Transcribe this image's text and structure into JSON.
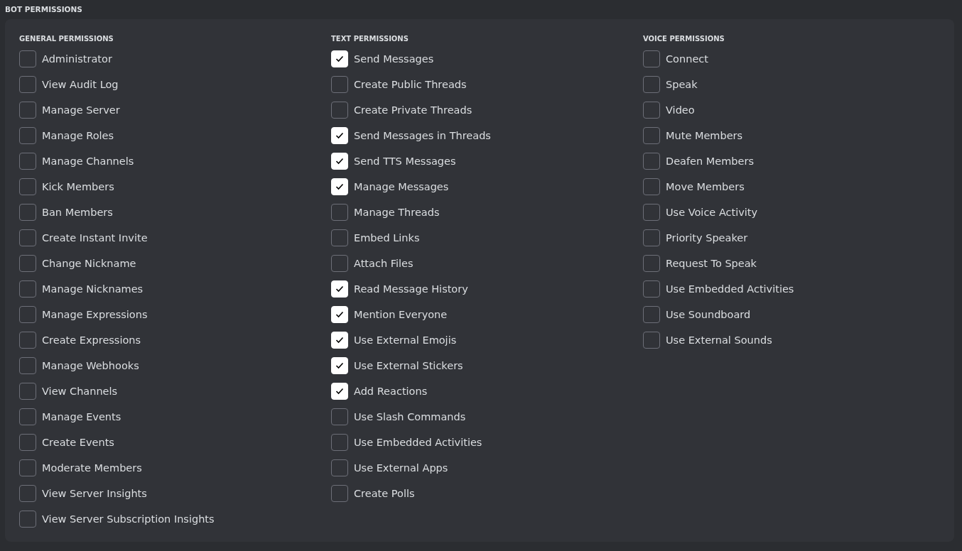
{
  "section_title": "BOT PERMISSIONS",
  "groups": [
    {
      "title": "GENERAL PERMISSIONS",
      "items": [
        {
          "label": "Administrator",
          "checked": false
        },
        {
          "label": "View Audit Log",
          "checked": false
        },
        {
          "label": "Manage Server",
          "checked": false
        },
        {
          "label": "Manage Roles",
          "checked": false
        },
        {
          "label": "Manage Channels",
          "checked": false
        },
        {
          "label": "Kick Members",
          "checked": false
        },
        {
          "label": "Ban Members",
          "checked": false
        },
        {
          "label": "Create Instant Invite",
          "checked": false
        },
        {
          "label": "Change Nickname",
          "checked": false
        },
        {
          "label": "Manage Nicknames",
          "checked": false
        },
        {
          "label": "Manage Expressions",
          "checked": false
        },
        {
          "label": "Create Expressions",
          "checked": false
        },
        {
          "label": "Manage Webhooks",
          "checked": false
        },
        {
          "label": "View Channels",
          "checked": false
        },
        {
          "label": "Manage Events",
          "checked": false
        },
        {
          "label": "Create Events",
          "checked": false
        },
        {
          "label": "Moderate Members",
          "checked": false
        },
        {
          "label": "View Server Insights",
          "checked": false
        },
        {
          "label": "View Server Subscription Insights",
          "checked": false
        }
      ]
    },
    {
      "title": "TEXT PERMISSIONS",
      "items": [
        {
          "label": "Send Messages",
          "checked": true
        },
        {
          "label": "Create Public Threads",
          "checked": false
        },
        {
          "label": "Create Private Threads",
          "checked": false
        },
        {
          "label": "Send Messages in Threads",
          "checked": true
        },
        {
          "label": "Send TTS Messages",
          "checked": true
        },
        {
          "label": "Manage Messages",
          "checked": true
        },
        {
          "label": "Manage Threads",
          "checked": false
        },
        {
          "label": "Embed Links",
          "checked": false
        },
        {
          "label": "Attach Files",
          "checked": false
        },
        {
          "label": "Read Message History",
          "checked": true
        },
        {
          "label": "Mention Everyone",
          "checked": true
        },
        {
          "label": "Use External Emojis",
          "checked": true
        },
        {
          "label": "Use External Stickers",
          "checked": true
        },
        {
          "label": "Add Reactions",
          "checked": true
        },
        {
          "label": "Use Slash Commands",
          "checked": false
        },
        {
          "label": "Use Embedded Activities",
          "checked": false
        },
        {
          "label": "Use External Apps",
          "checked": false
        },
        {
          "label": "Create Polls",
          "checked": false
        }
      ]
    },
    {
      "title": "VOICE PERMISSIONS",
      "items": [
        {
          "label": "Connect",
          "checked": false
        },
        {
          "label": "Speak",
          "checked": false
        },
        {
          "label": "Video",
          "checked": false
        },
        {
          "label": "Mute Members",
          "checked": false
        },
        {
          "label": "Deafen Members",
          "checked": false
        },
        {
          "label": "Move Members",
          "checked": false
        },
        {
          "label": "Use Voice Activity",
          "checked": false
        },
        {
          "label": "Priority Speaker",
          "checked": false
        },
        {
          "label": "Request To Speak",
          "checked": false
        },
        {
          "label": "Use Embedded Activities",
          "checked": false
        },
        {
          "label": "Use Soundboard",
          "checked": false
        },
        {
          "label": "Use External Sounds",
          "checked": false
        }
      ]
    }
  ]
}
